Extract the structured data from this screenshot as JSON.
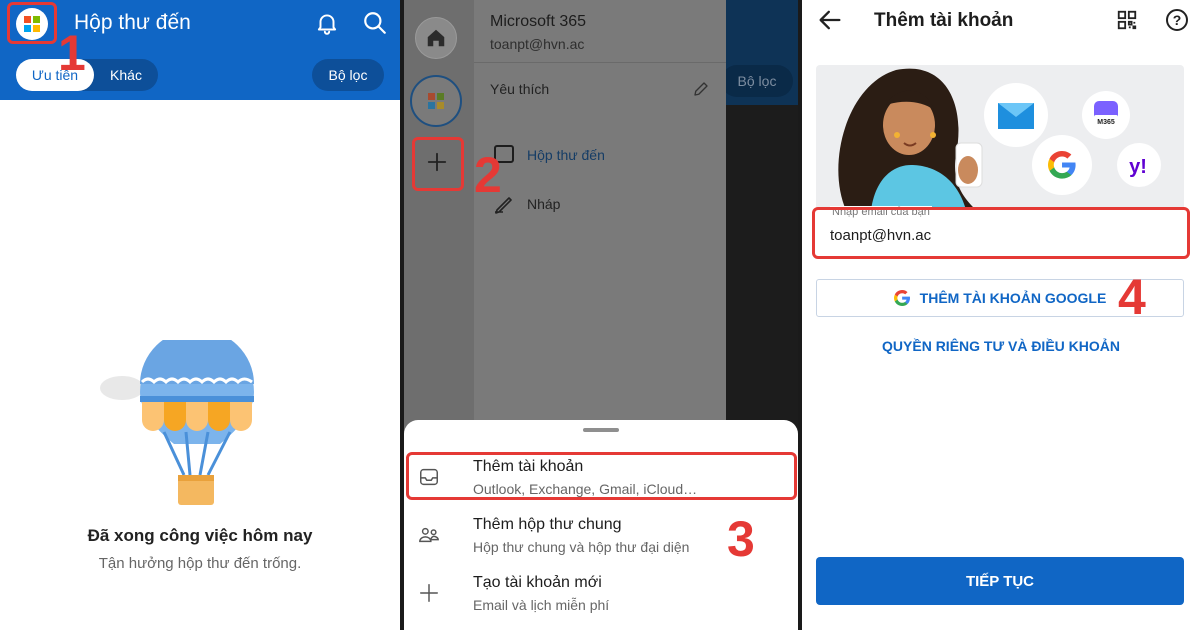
{
  "panel1": {
    "title": "Hộp thư đến",
    "tabs": [
      {
        "label": "Ưu tiên",
        "active": true
      },
      {
        "label": "Khác",
        "active": false
      }
    ],
    "filter_label": "Bộ lọc",
    "empty_title": "Đã xong công việc hôm nay",
    "empty_subtitle": "Tận hưởng hộp thư đến trống.",
    "step": "1",
    "icons": [
      "microsoft-logo-icon",
      "bell-icon",
      "search-icon",
      "hot-air-balloon-illustration"
    ]
  },
  "panel2": {
    "account_name": "Microsoft 365",
    "account_email": "toanpt@hvn.ac",
    "favorites_label": "Yêu thích",
    "folders": [
      {
        "label": "Hộp thư đến",
        "icon": "inbox-icon"
      },
      {
        "label": "Nháp",
        "icon": "draft-icon"
      }
    ],
    "background_filter_label": "Bộ lọc",
    "sheet_items": [
      {
        "title": "Thêm tài khoản",
        "subtitle": "Outlook, Exchange, Gmail, iCloud…",
        "icon": "inbox-tray-icon"
      },
      {
        "title": "Thêm hộp thư chung",
        "subtitle": "Hộp thư chung và hộp thư đại diện",
        "icon": "people-icon"
      },
      {
        "title": "Tạo tài khoản mới",
        "subtitle": "Email và lịch miễn phí",
        "icon": "plus-icon"
      }
    ],
    "steps": [
      "2",
      "3"
    ]
  },
  "panel3": {
    "title": "Thêm tài khoản",
    "email_label": "Nhập email của bạn",
    "email_value": "toanpt@hvn.ac",
    "google_button": "THÊM TÀI KHOẢN GOOGLE",
    "privacy_link": "QUYỀN RIÊNG TƯ VÀ ĐIỀU KHOẢN",
    "continue_button": "TIẾP TỤC",
    "m365_badge": "M365",
    "step": "4",
    "icons": [
      "back-arrow-icon",
      "qr-code-icon",
      "help-icon"
    ]
  },
  "colors": {
    "brand_blue": "#1066c5",
    "highlight_red": "#e53935",
    "ms_red": "#f25022",
    "ms_green": "#7fba00",
    "ms_blue": "#00a4ef",
    "ms_yellow": "#ffb900"
  }
}
